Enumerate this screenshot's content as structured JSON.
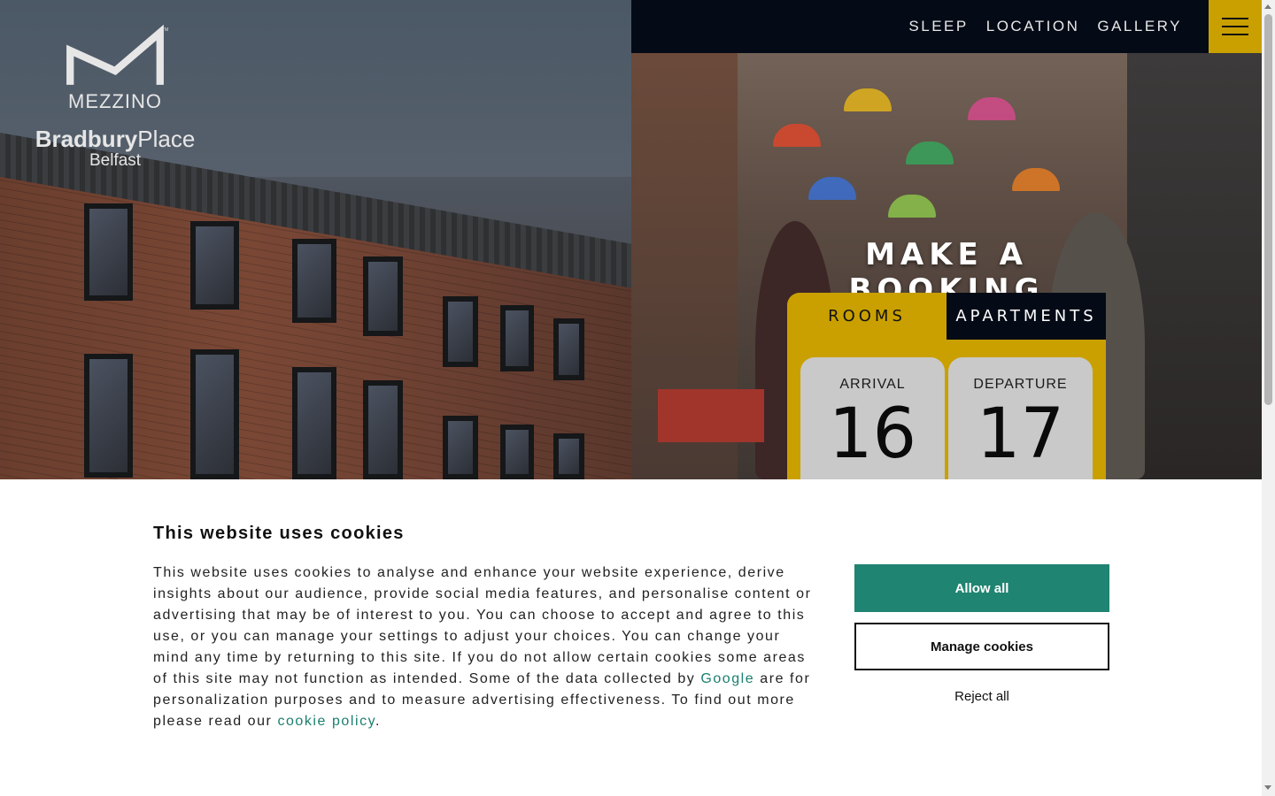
{
  "logo": {
    "brand": "MEZZINO",
    "place_bold": "Bradbury",
    "place_light": "Place",
    "city": "Belfast"
  },
  "nav": {
    "links": [
      "SLEEP",
      "LOCATION",
      "GALLERY"
    ],
    "menu_icon": "hamburger-icon"
  },
  "booking": {
    "title": "MAKE A BOOKING",
    "tabs": [
      "ROOMS",
      "APARTMENTS"
    ],
    "arrival_label": "ARRIVAL",
    "arrival_day": "16",
    "departure_label": "DEPARTURE",
    "departure_day": "17"
  },
  "cookie": {
    "title": "This website uses cookies",
    "text_part1": "This website uses cookies to analyse and enhance your website experience, derive insights about our audience, provide social media features, and personalise content or advertising that may be of interest to you. You can choose to accept and agree to this use, or you can manage your settings to adjust your choices. You can change your mind any time by returning to this site. If you do not allow certain cookies some areas of this site may not function as intended. Some of the data collected by ",
    "google_link": "Google",
    "text_part2": " are for personalization purposes and to measure advertising effectiveness. To find out more please read our ",
    "policy_link": "cookie policy",
    "text_end": ".",
    "allow_label": "Allow all",
    "manage_label": "Manage cookies",
    "reject_label": "Reject all"
  },
  "colors": {
    "accent_gold": "#c9a000",
    "nav_dark": "#050b16",
    "allow_green": "#1f8471",
    "link_teal": "#1a7f6f"
  }
}
